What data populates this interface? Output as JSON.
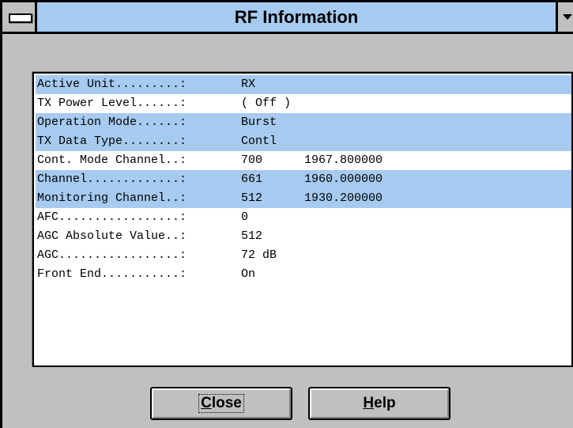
{
  "window": {
    "title": "RF Information"
  },
  "rows": [
    {
      "label": "Active Unit.........:",
      "v1": "RX",
      "v2": "",
      "highlighted": true
    },
    {
      "label": "TX Power Level......:",
      "v1": "( Off )",
      "v2": "",
      "highlighted": false
    },
    {
      "label": "Operation Mode......:",
      "v1": "Burst",
      "v2": "",
      "highlighted": true
    },
    {
      "label": "TX Data Type........:",
      "v1": "Contl",
      "v2": "",
      "highlighted": true
    },
    {
      "label": "Cont. Mode Channel..:",
      "v1": "700",
      "v2": "1967.800000",
      "highlighted": false
    },
    {
      "label": "Channel.............:",
      "v1": "661",
      "v2": "1960.000000",
      "highlighted": true
    },
    {
      "label": "Monitoring Channel..:",
      "v1": "512",
      "v2": "1930.200000",
      "highlighted": true
    },
    {
      "label": "AFC.................:",
      "v1": "0",
      "v2": "",
      "highlighted": false
    },
    {
      "label": "AGC Absolute Value..:",
      "v1": "512",
      "v2": "",
      "highlighted": false
    },
    {
      "label": "AGC.................:",
      "v1": "72 dB",
      "v2": "",
      "highlighted": false
    },
    {
      "label": "Front End...........:",
      "v1": "On",
      "v2": "",
      "highlighted": false
    }
  ],
  "buttons": {
    "close": {
      "mnemonic": "C",
      "rest": "lose"
    },
    "help": {
      "mnemonic": "H",
      "rest": "elp"
    }
  },
  "colors": {
    "highlight": "#a6caf0",
    "face": "#c0c0c0",
    "titlebar": "#a6caf0"
  }
}
